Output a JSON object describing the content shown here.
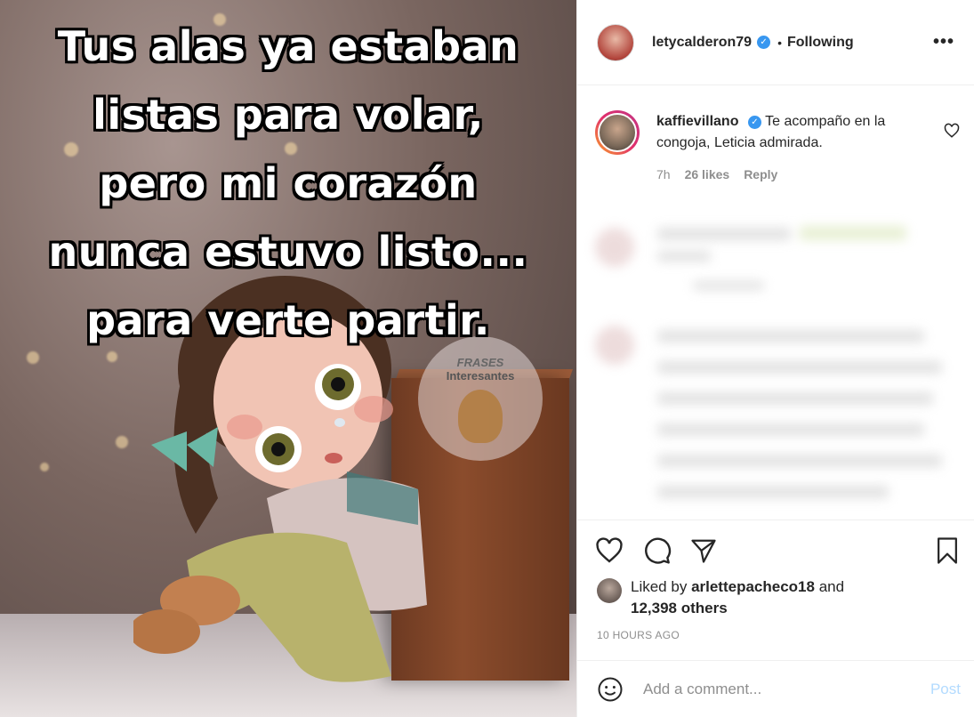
{
  "image": {
    "caption_lines": [
      "Tus alas ya estaban",
      "listas para volar,",
      "pero mi corazón",
      "nunca estuvo listo...",
      "para verte partir."
    ],
    "watermark_top": "FRASES",
    "watermark_bottom": "Interesantes"
  },
  "header": {
    "username": "letycalderon79",
    "verified_icon": "✓",
    "separator": "•",
    "following_label": "Following",
    "more_icon": "•••"
  },
  "comment": {
    "username": "kaffievillano",
    "verified_icon": "✓",
    "text": "Te acompaño en la congoja, Leticia admirada.",
    "time": "7h",
    "likes": "26 likes",
    "reply_label": "Reply"
  },
  "likes": {
    "prefix": "Liked by",
    "user": "arlettepacheco18",
    "conjunction": "and",
    "others": "12,398 others"
  },
  "timestamp": "10 HOURS AGO",
  "add_comment": {
    "placeholder": "Add a comment...",
    "post_label": "Post"
  },
  "colors": {
    "verified": "#3897f0",
    "post_disabled": "#b3dbff",
    "secondary_text": "#8e8e8e"
  }
}
